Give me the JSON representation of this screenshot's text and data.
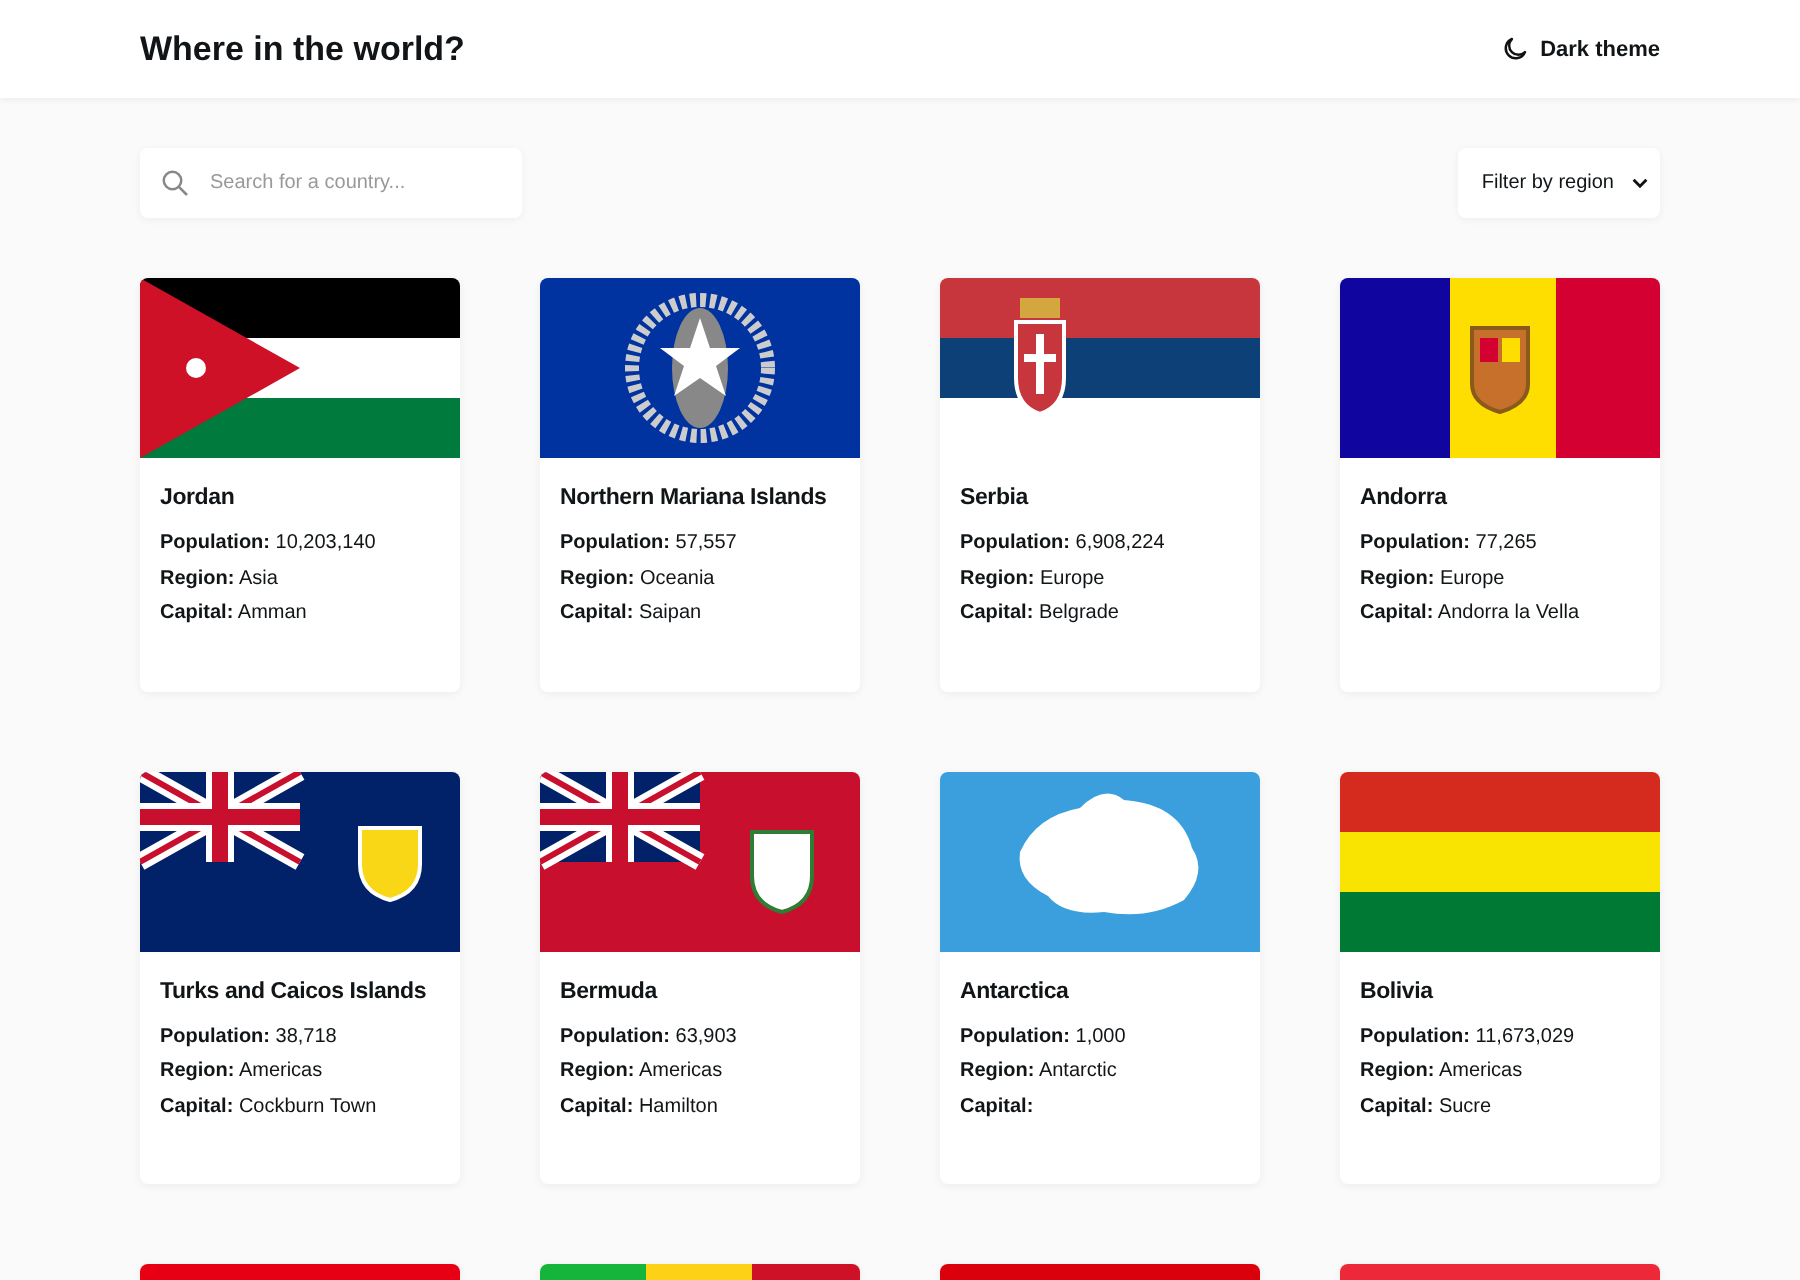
{
  "header": {
    "title": "Where in the world?",
    "theme_toggle": "Dark theme"
  },
  "search": {
    "placeholder": "Search for a country..."
  },
  "filter": {
    "label": "Filter by region"
  },
  "countries": [
    {
      "kind": "jordan",
      "name": "Jordan",
      "details": [
        "**Population:** 10,203,140",
        "**Region:** Asia",
        "**Capital:** Amman"
      ]
    },
    {
      "kind": "mariana",
      "name": "Northern Mariana Islands",
      "details": [
        "**Population:** 57,557",
        "**Region:** Oceania",
        "**Capital:** Saipan"
      ]
    },
    {
      "kind": "serbia",
      "name": "Serbia",
      "details": [
        "**Population:** 6,908,224",
        "**Region:** Europe",
        "**Capital:** Belgrade"
      ]
    },
    {
      "kind": "andorra",
      "name": "Andorra",
      "details": [
        "**Population:** 77,265",
        "**Region:** Europe",
        "**Capital:** Andorra la Vella"
      ]
    },
    {
      "kind": "turks",
      "name": "Turks and Caicos Islands",
      "details": [
        "**Population:** 38,718",
        "**Region:** Americas",
        "**Capital:** Cockburn Town"
      ]
    },
    {
      "kind": "bermuda",
      "name": "Bermuda",
      "details": [
        "**Population:** 63,903",
        "**Region:** Americas",
        "**Capital:** Hamilton"
      ]
    },
    {
      "kind": "antarctica",
      "name": "Antarctica",
      "details": [
        "**Population:** 1,000",
        "**Region:** Antarctic",
        "**Capital:**"
      ]
    },
    {
      "kind": "bolivia",
      "name": "Bolivia",
      "details": [
        "**Population:** 11,673,029",
        "**Region:** Americas",
        "**Capital:** Sucre"
      ]
    },
    {
      "kind": "red"
    },
    {
      "kind": "tricolor"
    },
    {
      "kind": "darkred"
    },
    {
      "kind": "rose"
    }
  ]
}
